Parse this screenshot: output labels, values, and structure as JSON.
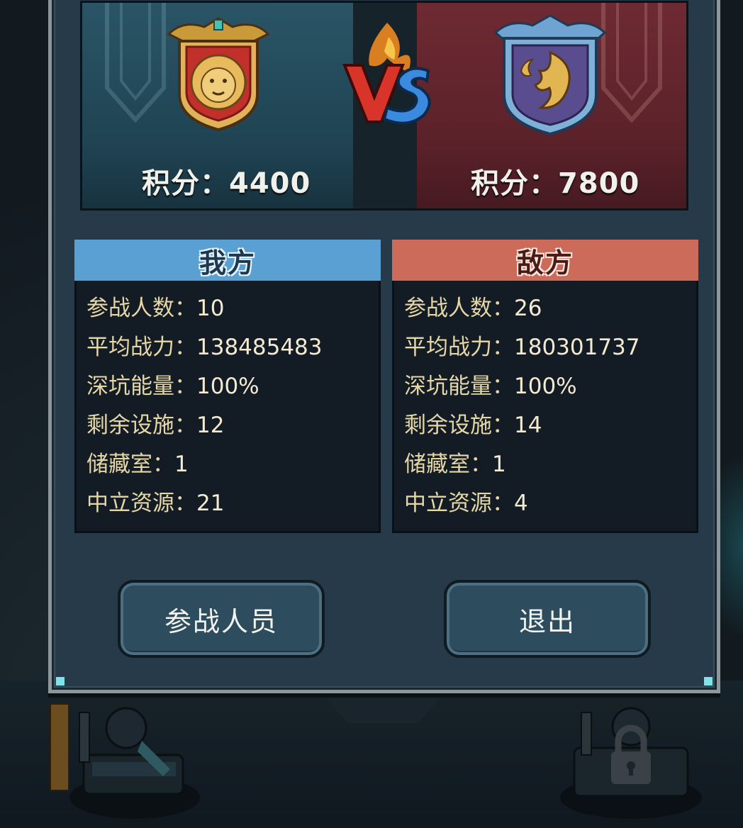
{
  "versus": {
    "our_score_text": "积分：4400",
    "enemy_score_text": "积分：7800",
    "our_emblem_icon": "lion-shield-icon",
    "enemy_emblem_icon": "flame-shield-icon",
    "vs_icon": "vs-flame-icon"
  },
  "our_team": {
    "title": "我方",
    "stats": [
      {
        "label": "参战人数：",
        "value": "10"
      },
      {
        "label": "平均战力：",
        "value": "138485483"
      },
      {
        "label": "深坑能量：",
        "value": "100%"
      },
      {
        "label": "剩余设施：",
        "value": "12"
      },
      {
        "label": "储藏室：",
        "value": "1"
      },
      {
        "label": "中立资源：",
        "value": "21"
      }
    ]
  },
  "enemy_team": {
    "title": "敌方",
    "stats": [
      {
        "label": "参战人数：",
        "value": "26"
      },
      {
        "label": "平均战力：",
        "value": "180301737"
      },
      {
        "label": "深坑能量：",
        "value": "100%"
      },
      {
        "label": "剩余设施：",
        "value": "14"
      },
      {
        "label": "储藏室：",
        "value": "1"
      },
      {
        "label": "中立资源：",
        "value": "4"
      }
    ]
  },
  "buttons": {
    "members_label": "参战人员",
    "exit_label": "退出"
  },
  "colors": {
    "our_header": "#5aa0d2",
    "enemy_header": "#cd6b5a",
    "dialog_bg": "#263a49",
    "stat_text": "#efe3b5"
  }
}
